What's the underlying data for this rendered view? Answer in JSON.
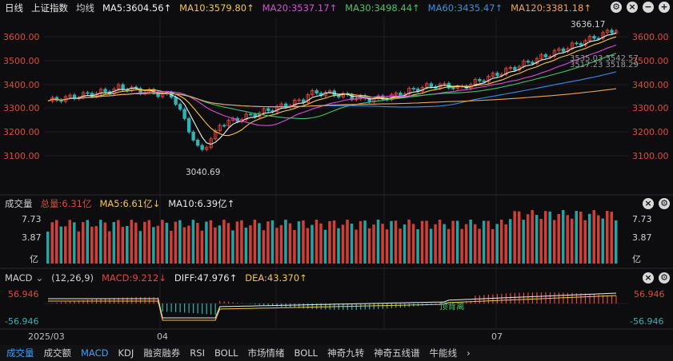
{
  "top": {
    "period": "日线",
    "index_name": "上证指数",
    "ma_label": "均线",
    "ma5": "MA5:3604.56↑",
    "ma10": "MA10:3579.80↑",
    "ma20": "MA20:3537.17↑",
    "ma30": "MA30:3498.44↑",
    "ma60": "MA60:3435.47↑",
    "ma120": "MA120:3381.18↑"
  },
  "colors": {
    "ma5": "#f0f0f0",
    "ma10": "#f4c842",
    "ma20": "#d64fd6",
    "ma30": "#43c66b",
    "ma60": "#3a8de6",
    "ma120": "#f0a35a",
    "up": "#e8453c",
    "down": "#2fb3b3"
  },
  "price_axis": [
    "3600.00",
    "3500.00",
    "3400.00",
    "3300.00",
    "3200.00",
    "3100.00"
  ],
  "annotations": {
    "high": "3636.17",
    "low": "3040.69",
    "ma_values_right": "3535.03  3542.57",
    "ma_values_right2": "3517.23  3518.29"
  },
  "volume": {
    "label": "成交量",
    "total": "总量:6.31亿",
    "ma5": "MA5:6.61亿↓",
    "ma10": "MA10:6.39亿↑",
    "axis": [
      "7.73",
      "3.87",
      "亿"
    ]
  },
  "macd": {
    "label": "MACD",
    "params": "(12,26,9)",
    "macd": "MACD:9.212↓",
    "diff": "DIFF:47.976↑",
    "dea": "DEA:43.370↑",
    "axis_top": "56.946",
    "axis_bottom": "-56.946",
    "signal": "顶背离"
  },
  "dates": [
    "2025/03",
    "04",
    "07"
  ],
  "tabs": [
    "成交量",
    "成交额",
    "MACD",
    "KDJ",
    "融资融券",
    "RSI",
    "BOLL",
    "市场情绪",
    "BOLL",
    "神奇九转",
    "神奇五线谱",
    "牛能线"
  ],
  "chart_data": {
    "type": "line",
    "title": "上证指数 日线",
    "y_range": [
      3040.69,
      3636.17
    ],
    "series": [
      {
        "name": "MA5",
        "last": 3604.56
      },
      {
        "name": "MA10",
        "last": 3579.8
      },
      {
        "name": "MA20",
        "last": 3537.17
      },
      {
        "name": "MA30",
        "last": 3498.44
      },
      {
        "name": "MA60",
        "last": 3435.47
      },
      {
        "name": "MA120",
        "last": 3381.18
      }
    ]
  }
}
